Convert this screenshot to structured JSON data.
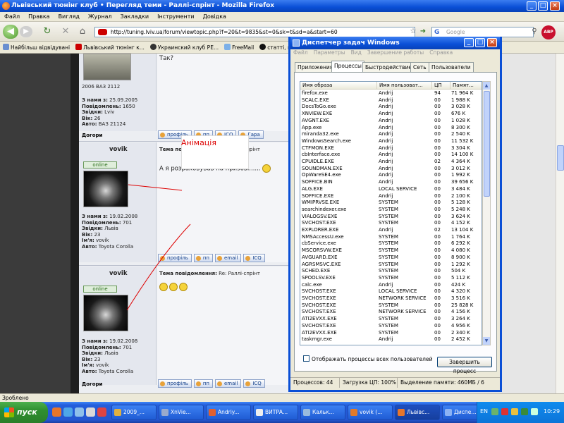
{
  "firefox": {
    "title": "Львівський тюнінг клуб • Перегляд теми - Раллі-спрінт - Mozilla Firefox",
    "menu": [
      "Файл",
      "Правка",
      "Вигляд",
      "Журнал",
      "Закладки",
      "Інструменти",
      "Довідка"
    ],
    "url": "http://tuning.lviv.ua/forum/viewtopic.php?f=20&t=9835&st=0&sk=t&sd=a&start=60",
    "search_placeholder": "Google",
    "abp_label": "ABP",
    "bookmarks": [
      "Найбільш відвідувані",
      "Львівський тюнінг к...",
      "Украинский клуб РЕ...",
      "FreeMail",
      "статті, новини"
    ],
    "status_text": "Зроблено"
  },
  "forum": {
    "first_post": {
      "reply_text": "Так?",
      "car_caption": "2006 ВАЗ 2112",
      "meta": [
        {
          "k": "З нами з:",
          "v": "25.09.2005"
        },
        {
          "k": "Повідомлень:",
          "v": "1650"
        },
        {
          "k": "Звідки:",
          "v": "Lviv"
        },
        {
          "k": "Вік:",
          "v": "26"
        },
        {
          "k": "Авто:",
          "v": "ВАЗ 21124"
        }
      ],
      "up_label": "Догори",
      "buttons": [
        "профіль",
        "пп",
        "ICQ",
        "Гара"
      ]
    },
    "post2": {
      "username": "vovik",
      "subject_label": "Тема повідомлення:",
      "subject": "Re: Раллі-спрінт",
      "online": "online",
      "message": "А я розраховував на призові......",
      "meta": [
        {
          "k": "З нами з:",
          "v": "19.02.2008"
        },
        {
          "k": "Повідомлень:",
          "v": "701"
        },
        {
          "k": "Звідки:",
          "v": "Львів"
        },
        {
          "k": "Вік:",
          "v": "23"
        },
        {
          "k": "Ім'я:",
          "v": "vovik"
        },
        {
          "k": "Авто:",
          "v": "Toyota Corolla"
        }
      ],
      "buttons": [
        "профіль",
        "пп",
        "email",
        "ICQ"
      ]
    },
    "post3": {
      "username": "vovik",
      "subject_label": "Тема повідомлення:",
      "subject": "Re: Раллі-спрінт",
      "online": "online",
      "meta": [
        {
          "k": "З нами з:",
          "v": "19.02.2008"
        },
        {
          "k": "Повідомлень:",
          "v": "701"
        },
        {
          "k": "Звідки:",
          "v": "Львів"
        },
        {
          "k": "Вік:",
          "v": "23"
        },
        {
          "k": "Ім'я:",
          "v": "vovik"
        },
        {
          "k": "Авто:",
          "v": "Toyota Corolla"
        }
      ],
      "up_label": "Догори",
      "buttons": [
        "профіль",
        "пп",
        "email",
        "ICQ"
      ]
    },
    "annotation": "Анімація"
  },
  "taskmgr": {
    "title": "Диспетчер задач Windows",
    "menu": [
      "Файл",
      "Параметры",
      "Вид",
      "Завершение работы",
      "Справка"
    ],
    "tabs": [
      "Приложения",
      "Процессы",
      "Быстродействие",
      "Сеть",
      "Пользователи"
    ],
    "active_tab": "Процессы",
    "columns": [
      "Имя образа",
      "Имя пользоват...",
      "ЦП",
      "Памят..."
    ],
    "processes": [
      [
        "firefox.exe",
        "Andrij",
        "94",
        "71 964 K"
      ],
      [
        "SCALC.EXE",
        "Andrij",
        "00",
        "1 988 K"
      ],
      [
        "DocsToGo.exe",
        "Andrij",
        "00",
        "3 028 K"
      ],
      [
        "XNVIEW.EXE",
        "Andrij",
        "00",
        "676 K"
      ],
      [
        "AVGNT.EXE",
        "Andrij",
        "00",
        "1 028 K"
      ],
      [
        "App.exe",
        "Andrij",
        "00",
        "8 300 K"
      ],
      [
        "miranda32.exe",
        "Andrij",
        "00",
        "2 540 K"
      ],
      [
        "WindowsSearch.exe",
        "Andrij",
        "00",
        "11 532 K"
      ],
      [
        "CTFMON.EXE",
        "Andrij",
        "00",
        "3 304 K"
      ],
      [
        "cbInterface.exe",
        "Andrij",
        "00",
        "14 100 K"
      ],
      [
        "CPUIDLE.EXE",
        "Andrij",
        "02",
        "4 364 K"
      ],
      [
        "SOUNDMAN.EXE",
        "Andrij",
        "00",
        "3 012 K"
      ],
      [
        "OpWareSE4.exe",
        "Andrij",
        "00",
        "1 992 K"
      ],
      [
        "SOFFICE.BIN",
        "Andrij",
        "00",
        "39 656 K"
      ],
      [
        "ALG.EXE",
        "LOCAL SERVICE",
        "00",
        "3 484 K"
      ],
      [
        "SOFFICE.EXE",
        "Andrij",
        "00",
        "2 100 K"
      ],
      [
        "WMIPRVSE.EXE",
        "SYSTEM",
        "00",
        "5 128 K"
      ],
      [
        "searchindexer.exe",
        "SYSTEM",
        "00",
        "5 248 K"
      ],
      [
        "VIALOGSV.EXE",
        "SYSTEM",
        "00",
        "3 624 K"
      ],
      [
        "SVCHOST.EXE",
        "SYSTEM",
        "00",
        "4 152 K"
      ],
      [
        "EXPLORER.EXE",
        "Andrij",
        "02",
        "13 104 K"
      ],
      [
        "NMSAccessU.exe",
        "SYSTEM",
        "00",
        "1 764 K"
      ],
      [
        "cbService.exe",
        "SYSTEM",
        "00",
        "6 292 K"
      ],
      [
        "MSCORSVW.EXE",
        "SYSTEM",
        "00",
        "4 080 K"
      ],
      [
        "AVGUARD.EXE",
        "SYSTEM",
        "00",
        "8 900 K"
      ],
      [
        "AGRSMSVC.EXE",
        "SYSTEM",
        "00",
        "1 292 K"
      ],
      [
        "SCHED.EXE",
        "SYSTEM",
        "00",
        "504 K"
      ],
      [
        "SPOOLSV.EXE",
        "SYSTEM",
        "00",
        "5 112 K"
      ],
      [
        "calc.exe",
        "Andrij",
        "00",
        "424 K"
      ],
      [
        "SVCHOST.EXE",
        "LOCAL SERVICE",
        "00",
        "4 320 K"
      ],
      [
        "SVCHOST.EXE",
        "NETWORK SERVICE",
        "00",
        "3 516 K"
      ],
      [
        "SVCHOST.EXE",
        "SYSTEM",
        "00",
        "25 828 K"
      ],
      [
        "SVCHOST.EXE",
        "NETWORK SERVICE",
        "00",
        "4 156 K"
      ],
      [
        "ATI2EVXX.EXE",
        "SYSTEM",
        "00",
        "3 264 K"
      ],
      [
        "SVCHOST.EXE",
        "SYSTEM",
        "00",
        "4 956 K"
      ],
      [
        "ATI2EVXX.EXE",
        "SYSTEM",
        "00",
        "2 340 K"
      ],
      [
        "taskmgr.exe",
        "Andrij",
        "00",
        "2 452 K"
      ]
    ],
    "show_all_label": "Отображать процессы всех пользователей",
    "end_process_label": "Завершить процесс",
    "status": {
      "processes": "Процессов: 44",
      "cpu": "Загрузка ЦП: 100%",
      "mem": "Выделение памяти: 460МБ / 6"
    }
  },
  "taskbar": {
    "start_label": "пуск",
    "tasks": [
      "2009_...",
      "XnVie...",
      "Andriy...",
      "ВИТРА...",
      "Кальк...",
      "vovik (...",
      "Львівс...",
      "Диспе..."
    ],
    "language": "EN",
    "clock": "10:29"
  },
  "colors": {
    "titlebar": "#0a4fd6",
    "annotation_red": "#dd0000",
    "taskbar": "#245edb"
  }
}
